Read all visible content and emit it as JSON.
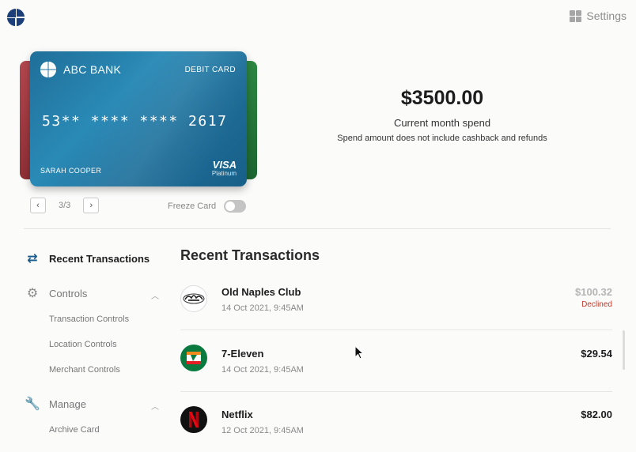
{
  "header": {
    "logo_icon": "quarter-circle-logo",
    "settings_label": "Settings",
    "settings_icon": "grid-icon"
  },
  "card": {
    "bank_name": "ABC BANK",
    "card_type": "DEBIT CARD",
    "number": "53** **** **** 2617",
    "holder": "SARAH COOPER",
    "brand": "VISA",
    "tier": "Platinum",
    "color": "#1f6f99",
    "stack_colors": [
      "#b3474e",
      "#2f8d45"
    ]
  },
  "pager": {
    "prev_icon": "chevron-left-icon",
    "next_icon": "chevron-right-icon",
    "label": "3/3"
  },
  "freeze": {
    "label": "Freeze Card",
    "enabled": false
  },
  "spend": {
    "amount": "$3500.00",
    "label": "Current month spend",
    "note": "Spend amount does not include cashback and refunds"
  },
  "sidebar": {
    "recent": {
      "label": "Recent Transactions",
      "icon": "swap-arrows-icon"
    },
    "controls": {
      "label": "Controls",
      "icon": "gear-icon",
      "items": [
        "Transaction Controls",
        "Location Controls",
        "Merchant Controls"
      ]
    },
    "manage": {
      "label": "Manage",
      "icon": "wrench-icon",
      "items": [
        "Archive Card"
      ]
    }
  },
  "transactions": {
    "title": "Recent Transactions",
    "rows": [
      {
        "name": "Old Naples Club",
        "date": "14 Oct 2021, 9:45AM",
        "amount": "$100.32",
        "status": "Declined",
        "logo": "old-naples-club-logo"
      },
      {
        "name": "7-Eleven",
        "date": "14 Oct 2021, 9:45AM",
        "amount": "$29.54",
        "status": "",
        "logo": "seven-eleven-logo"
      },
      {
        "name": "Netflix",
        "date": "12 Oct 2021, 9:45AM",
        "amount": "$82.00",
        "status": "",
        "logo": "netflix-logo"
      }
    ]
  }
}
